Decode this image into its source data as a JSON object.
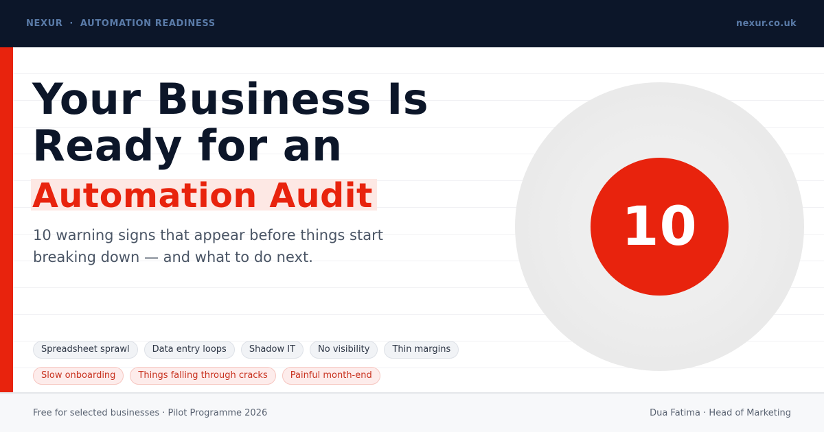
{
  "topbar": {
    "brand": "NEXUR",
    "separator": "·",
    "section": "AUTOMATION READINESS",
    "url": "nexur.co.uk"
  },
  "headline": {
    "line1": "Your Business Is",
    "line2": "Ready for an",
    "highlight": "Automation Audit"
  },
  "subtitle": "10 warning signs that appear before things start breaking down — and what to do next.",
  "chips": {
    "neutral": [
      "Spreadsheet sprawl",
      "Data entry loops",
      "Shadow IT",
      "No visibility",
      "Thin margins"
    ],
    "alert": [
      "Slow onboarding",
      "Things falling through cracks",
      "Painful month-end"
    ]
  },
  "badge": {
    "number": "10"
  },
  "footer": {
    "left": "Free for selected businesses · Pilot Programme 2026",
    "right": "Dua Fatima · Head of Marketing"
  },
  "colors": {
    "navy": "#0c1629",
    "accent_red": "#e8230d",
    "brand_blue": "#5a7ba8"
  }
}
